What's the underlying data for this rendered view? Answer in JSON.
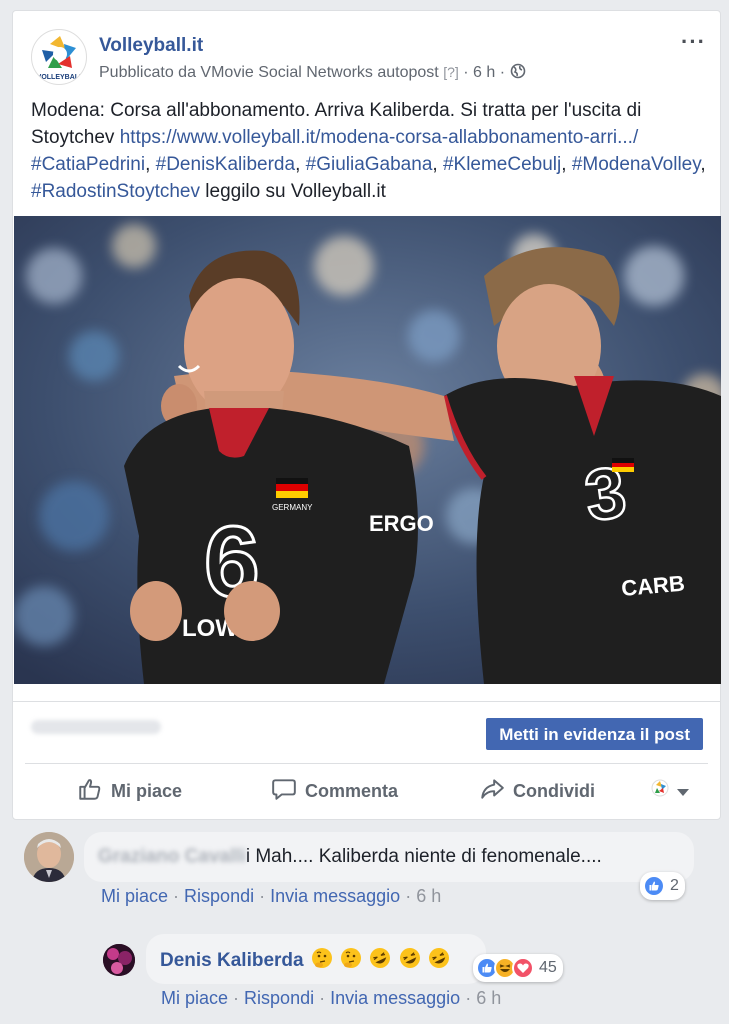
{
  "post": {
    "page_name": "Volleyball.it",
    "published_by_label": "Pubblicato da",
    "published_by": "VMovie Social Networks autopost",
    "help_marker": "[?]",
    "separator": "·",
    "time": "6 h",
    "logo_text": "VOLLEYBALL",
    "text_intro": "Modena: Corsa all'abbonamento. Arriva Kaliberda. Si tratta per l'uscita di Stoytchev ",
    "link": "https://www.volleyball.it/modena-corsa-allabbonamento-arri.../",
    "hashtags": [
      "#CatiaPedrini",
      "#DenisKaliberda",
      "#GiuliaGabana",
      "#KlemeCebulj",
      "#ModenaVolley",
      "#RadostinStoytchev"
    ],
    "comma": ", ",
    "text_outro": " leggilo su Volleyball.it",
    "boost_label": "Metti in evidenza il post"
  },
  "photo": {
    "left_number": "6",
    "right_number": "3",
    "left_sponsor": "ERGO",
    "left_brand": "LOWO",
    "right_sponsor": "CARB",
    "country": "GERMANY"
  },
  "actions": {
    "like": "Mi piace",
    "comment": "Commenta",
    "share": "Condividi"
  },
  "comments": [
    {
      "author": "Graziano Cavalli",
      "text": "i Mah.... Kaliberda niente di fenomenale....",
      "reaction_count": "2",
      "like_label": "Mi piace",
      "reply_label": "Rispondi",
      "message_label": "Invia messaggio",
      "time": "6 h"
    },
    {
      "author": "Denis Kaliberda",
      "emoji_summary": "thinking x2, rolling-on-floor-laughing x3",
      "reaction_count": "45",
      "like_label": "Mi piace",
      "reply_label": "Rispondi",
      "message_label": "Invia messaggio",
      "time": "6 h"
    }
  ],
  "colors": {
    "brand_blue": "#4267b2",
    "link_blue": "#365899",
    "jersey": "#1f1f1f",
    "collar_red": "#c0202c"
  }
}
